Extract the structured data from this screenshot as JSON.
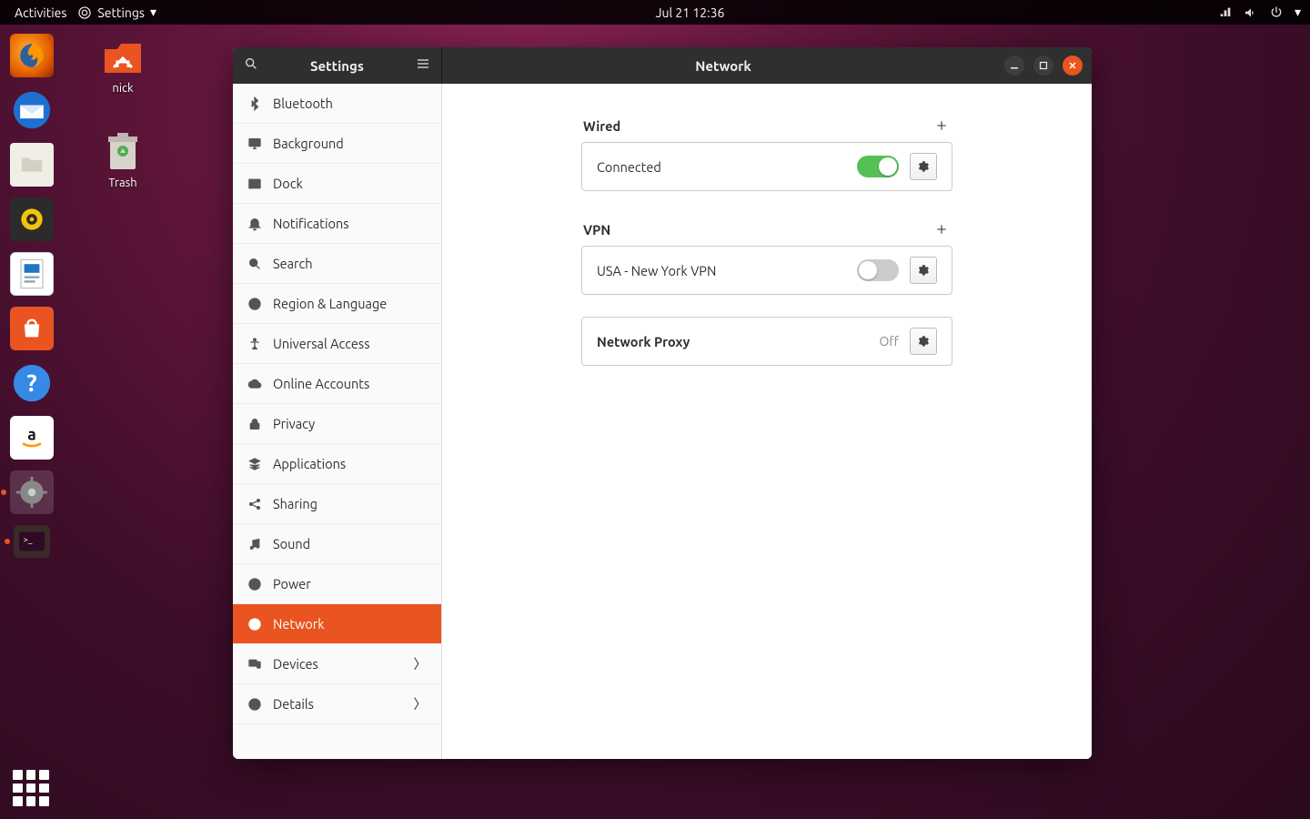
{
  "topbar": {
    "activities": "Activities",
    "app_menu": "Settings",
    "clock": "Jul 21  12:36"
  },
  "desktop": {
    "home_label": "nick",
    "trash_label": "Trash"
  },
  "window": {
    "sidebar_title": "Settings",
    "content_title": "Network"
  },
  "sidebar": {
    "items": [
      {
        "label": "Bluetooth"
      },
      {
        "label": "Background"
      },
      {
        "label": "Dock"
      },
      {
        "label": "Notifications"
      },
      {
        "label": "Search"
      },
      {
        "label": "Region & Language"
      },
      {
        "label": "Universal Access"
      },
      {
        "label": "Online Accounts"
      },
      {
        "label": "Privacy"
      },
      {
        "label": "Applications"
      },
      {
        "label": "Sharing"
      },
      {
        "label": "Sound"
      },
      {
        "label": "Power"
      },
      {
        "label": "Network"
      },
      {
        "label": "Devices"
      },
      {
        "label": "Details"
      }
    ]
  },
  "network": {
    "wired": {
      "heading": "Wired",
      "status": "Connected"
    },
    "vpn": {
      "heading": "VPN",
      "entry": "USA - New York VPN"
    },
    "proxy": {
      "heading": "Network Proxy",
      "status": "Off"
    }
  }
}
